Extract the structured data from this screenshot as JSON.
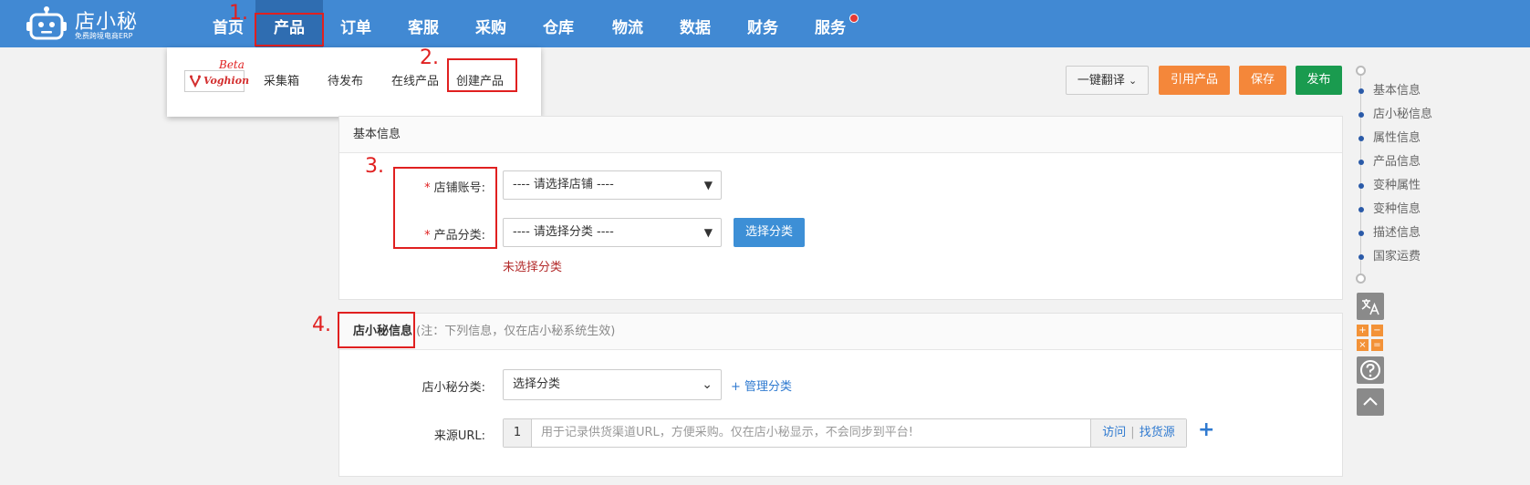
{
  "app": {
    "logo_name": "店小秘",
    "logo_sub": "免费跨境电商ERP"
  },
  "nav": {
    "items": [
      {
        "label": "首页"
      },
      {
        "label": "产品"
      },
      {
        "label": "订单"
      },
      {
        "label": "客服"
      },
      {
        "label": "采购"
      },
      {
        "label": "仓库"
      },
      {
        "label": "物流"
      },
      {
        "label": "数据"
      },
      {
        "label": "财务"
      },
      {
        "label": "服务"
      }
    ],
    "active": "产品"
  },
  "dropdown": {
    "beta_tag": "Beta",
    "beta_brand": "Voghion",
    "items": [
      {
        "label": "采集箱"
      },
      {
        "label": "待发布"
      },
      {
        "label": "在线产品"
      },
      {
        "label": "创建产品"
      }
    ]
  },
  "annotations": [
    "1.",
    "2.",
    "3.",
    "4."
  ],
  "actions": {
    "translate": "一键翻译",
    "import": "引用产品",
    "save": "保存",
    "publish": "发布"
  },
  "basic_info": {
    "title": "基本信息",
    "shop_label": "店铺账号:",
    "shop_placeholder": "---- 请选择店铺 ----",
    "category_label": "产品分类:",
    "category_placeholder": "---- 请选择分类 ----",
    "choose_category_btn": "选择分类",
    "error": "未选择分类"
  },
  "dxm_info": {
    "title": "店小秘信息",
    "note": "(注：下列信息，仅在店小秘系统生效)",
    "category_label": "店小秘分类:",
    "category_value": "选择分类",
    "manage_link": "+ 管理分类",
    "url_label": "来源URL:",
    "url_index": "1",
    "url_placeholder": "用于记录供货渠道URL，方便采购。仅在店小秘显示，不会同步到平台!",
    "visit_link": "访问",
    "source_link": "找货源"
  },
  "anchor_nav": {
    "items": [
      "基本信息",
      "店小秘信息",
      "属性信息",
      "产品信息",
      "变种属性",
      "变种信息",
      "描述信息",
      "国家运费"
    ]
  },
  "tools": [
    "translate-icon",
    "calculator-icon",
    "help-icon",
    "back-to-top-icon"
  ],
  "colors": {
    "nav_bg": "#4189d3",
    "nav_active": "#2f6db1",
    "orange": "#f4873a",
    "green": "#1a9b4f",
    "blue": "#3d8fd6",
    "annotation_red": "#e02020"
  }
}
